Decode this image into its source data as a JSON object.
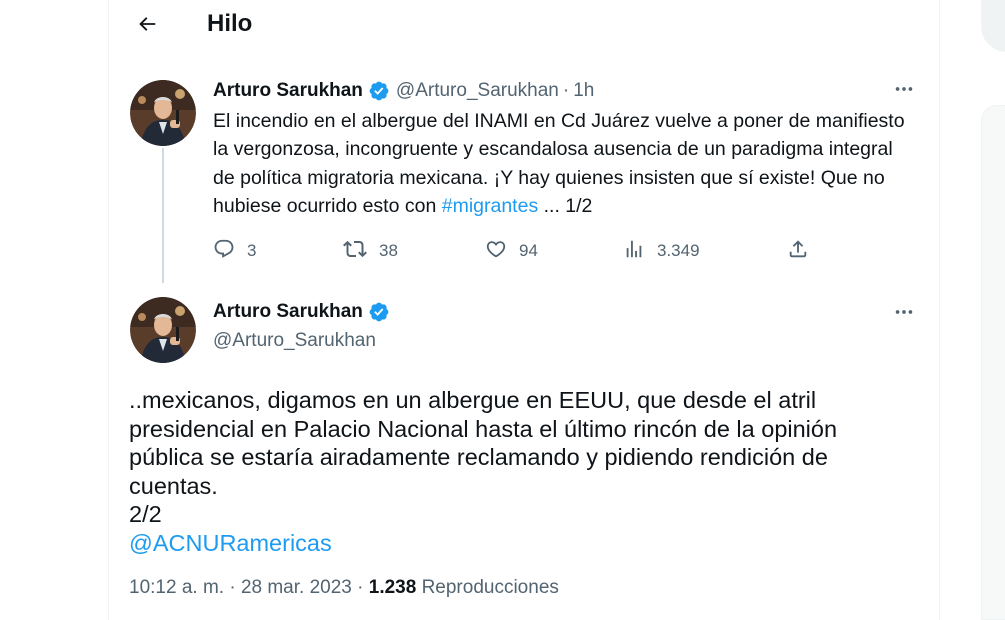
{
  "header": {
    "title": "Hilo",
    "back_icon": "arrow-left-icon"
  },
  "tweet1": {
    "author_name": "Arturo Sarukhan",
    "handle": "@Arturo_Sarukhan",
    "separator": "·",
    "time": "1h",
    "text_before_link": "El incendio en el albergue del INAMI en Cd Juárez vuelve a poner de manifiesto la vergonzosa, incongruente y escandalosa ausencia de un paradigma integral de política migratoria mexicana. ¡Y hay quienes insisten que sí existe! Que no hubiese ocurrido esto con ",
    "hashtag": "#migrantes",
    "text_after_link": " ... 1/2",
    "stats": {
      "replies": "3",
      "retweets": "38",
      "likes": "94",
      "views": "3.349"
    }
  },
  "tweet2": {
    "author_name": "Arturo Sarukhan",
    "handle": "@Arturo_Sarukhan",
    "lines": [
      "..mexicanos, digamos en un albergue en EEUU, que desde el atril",
      "presidencial en Palacio Nacional hasta el último rincón de la opinión",
      "pública se estaría airadamente reclamando y pidiendo rendición de",
      "cuentas.",
      "2/2"
    ],
    "mention": "@ACNURamericas",
    "timestamp": "10:12 a. m. · 28 mar. 2023 · ",
    "views_count": "1.238",
    "views_label": " Reproducciones"
  },
  "colors": {
    "accent": "#1d9bf0",
    "text": "#0f1419",
    "secondary": "#536471",
    "border": "#eff3f4"
  }
}
